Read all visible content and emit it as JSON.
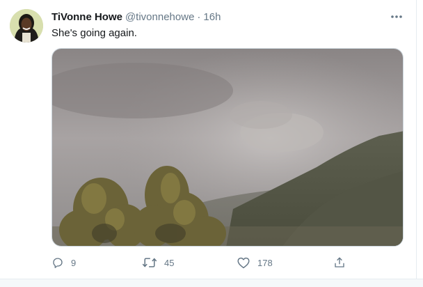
{
  "tweet": {
    "display_name": "TiVonne Howe",
    "handle": "@tivonnehowe",
    "separator": "·",
    "time": "16h",
    "text": "She's going again.",
    "avatar_icon": "user-avatar",
    "more_icon": "more-horizontal-icon",
    "media": {
      "type": "photo",
      "subject": "volcanic ash plume over mountains"
    },
    "actions": {
      "reply": {
        "icon": "reply-icon",
        "count": "9"
      },
      "retweet": {
        "icon": "retweet-icon",
        "count": "45"
      },
      "like": {
        "icon": "heart-icon",
        "count": "178"
      },
      "share": {
        "icon": "share-icon"
      }
    }
  },
  "colors": {
    "text_primary": "#14171a",
    "text_secondary": "#657786",
    "border": "#e6ecf0"
  }
}
